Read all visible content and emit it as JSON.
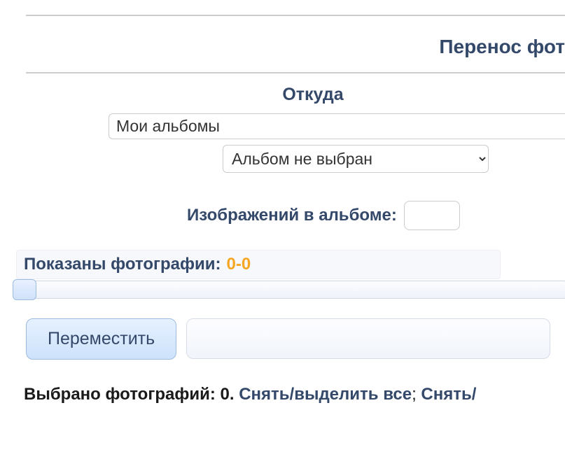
{
  "title": "Перенос фот",
  "from_label": "Откуда",
  "albums_input_value": "Мои альбомы",
  "album_select_value": "Альбом не выбран",
  "images_label": "Изображений в альбоме:",
  "images_count": "",
  "shown_label": "Показаны фотографии:",
  "shown_value": "0-0",
  "move_button": "Переместить",
  "selected_label": "Выбрано фотографий: ",
  "selected_count": "0.",
  "select_all_link": "Снять/выделить все",
  "select_sep": "; ",
  "select_trail": "Снять/"
}
